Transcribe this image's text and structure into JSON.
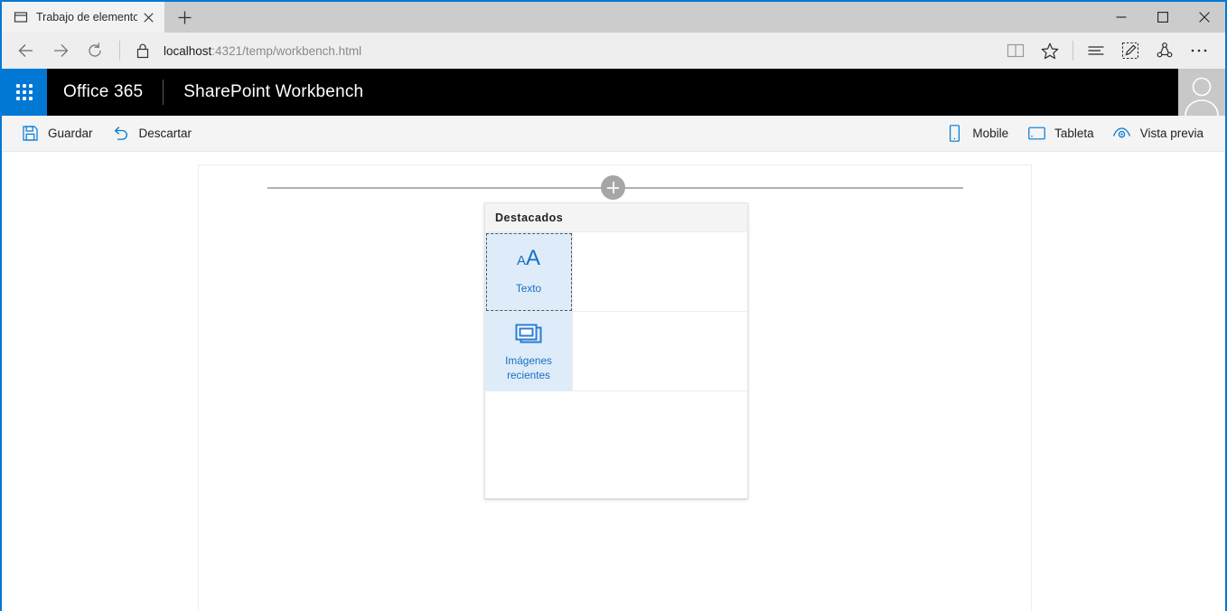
{
  "browser": {
    "tab": {
      "title": "Trabajo de elementos w",
      "favicon_icon": "page-icon",
      "close_icon": "close-icon"
    },
    "new_tab_label": "+",
    "window_controls": {
      "minimize": "—",
      "maximize": "□",
      "close": "✕"
    },
    "nav": {
      "back_icon": "arrow-left-icon",
      "forward_icon": "arrow-right-icon",
      "refresh_icon": "refresh-icon",
      "lock_icon": "lock-icon"
    },
    "address": {
      "host": "localhost",
      "path": ":4321/temp/workbench.html",
      "full_url": "localhost:4321/temp/workbench.html"
    },
    "toolbar": {
      "reading_view_icon": "book-icon",
      "favorites_icon": "star-icon",
      "hub_icon": "hub-lines-icon",
      "web_note_icon": "pencil-note-icon",
      "share_icon": "share-icon",
      "more_icon": "ellipsis-icon"
    }
  },
  "suitebar": {
    "waffle_icon": "app-launcher-waffle-icon",
    "brand": "Office 365",
    "app_name": "SharePoint Workbench",
    "avatar_icon": "user-avatar-icon",
    "accent_color": "#0078d4",
    "background_color": "#000000"
  },
  "commandbar": {
    "save": {
      "label": "Guardar",
      "icon": "save-floppy-icon"
    },
    "discard": {
      "label": "Descartar",
      "icon": "undo-arrow-icon"
    },
    "mobile": {
      "label": "Mobile",
      "icon": "phone-icon"
    },
    "tablet": {
      "label": "Tableta",
      "icon": "tablet-icon"
    },
    "preview": {
      "label": "Vista previa",
      "icon": "eye-preview-icon"
    },
    "icon_color": "#0078d4"
  },
  "canvas": {
    "add_section_icon": "plus-circle-icon",
    "add_section_label": "+"
  },
  "picker": {
    "header": "Destacados",
    "items": [
      {
        "label": "Texto",
        "icon": "text-aa-icon",
        "icon_text_small": "A",
        "icon_text_large": "A",
        "selected": true,
        "focused": true
      },
      {
        "label": "Imágenes recientes",
        "icon": "recent-images-icon",
        "selected": true,
        "focused": false
      }
    ],
    "selected_color": "#deecf9",
    "label_color": "#1b6ec2"
  }
}
